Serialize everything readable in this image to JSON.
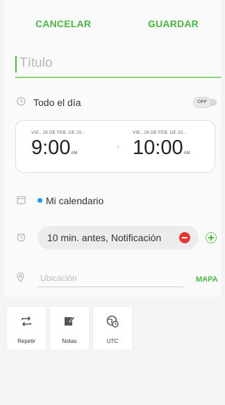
{
  "header": {
    "cancel_label": "CANCELAR",
    "save_label": "GUARDAR"
  },
  "title": {
    "placeholder": "Título",
    "value": ""
  },
  "all_day": {
    "label": "Todo el día",
    "toggle_text": "OFF",
    "enabled": false
  },
  "start": {
    "date": "VIE., 26 DE FEB. DE 20...",
    "time": "9:00",
    "ampm": "AM"
  },
  "end": {
    "date": "VIE., 26 DE FEB. DE 20...",
    "time": "10:00",
    "ampm": "AM"
  },
  "calendar": {
    "label": "Mi calendario",
    "color": "#2196f3"
  },
  "reminder": {
    "label": "10 min. antes, Notificación"
  },
  "location": {
    "placeholder": "Ubicación",
    "value": "",
    "map_label": "MAPA"
  },
  "tools": [
    {
      "label": "Repetir",
      "icon": "repeat-icon"
    },
    {
      "label": "Notas",
      "icon": "notes-icon"
    },
    {
      "label": "UTC",
      "icon": "timezone-icon"
    }
  ],
  "colors": {
    "accent": "#4bb543",
    "danger": "#e53935"
  }
}
